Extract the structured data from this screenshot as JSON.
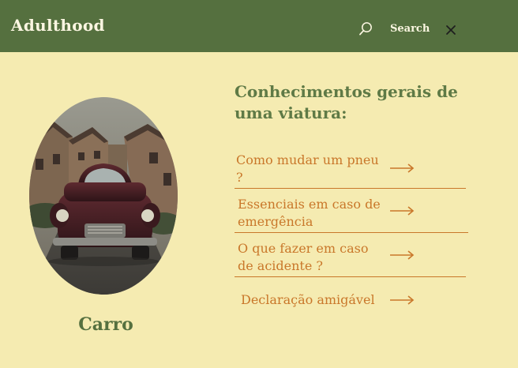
{
  "header": {
    "brand": "Adulthood",
    "search_label": "Search",
    "search_icon": "search-icon",
    "close_icon": "close-icon",
    "background_color": "#55703f"
  },
  "feature": {
    "image_alt": "vintage car on village street",
    "caption": "Carro"
  },
  "main": {
    "heading": "Conhecimentos gerais de uma viatura:",
    "links": [
      {
        "label": "Como mudar um pneu ?",
        "icon": "arrow-right-icon"
      },
      {
        "label": "Essenciais em caso de emergência",
        "icon": "arrow-right-icon"
      },
      {
        "label": "O que fazer em caso de acidente ?",
        "icon": "arrow-right-icon"
      },
      {
        "label": "Declaração amigável",
        "icon": "arrow-right-icon"
      }
    ]
  },
  "colors": {
    "page_background": "#f5ebb1",
    "accent_orange": "#c9772a",
    "brand_green": "#55703f"
  }
}
